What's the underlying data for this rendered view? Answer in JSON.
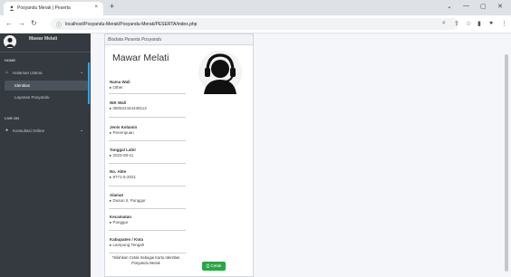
{
  "browser": {
    "tab_title": "Posyandu Merak | Peserta",
    "tab_close": "×",
    "new_tab": "+",
    "url": "localhost/Posyandu-Merak/Posyandu-Merak/PESERTA/index.php",
    "window_controls": [
      "⌄",
      "—",
      "▢",
      "✕"
    ]
  },
  "sidebar": {
    "brand_name": "Mawar Melati",
    "header_home": "HOME",
    "item_home": "Halaman Utama",
    "sub_items": [
      "Identitas",
      "Layanan Posyandu"
    ],
    "header_live": "LIVE ON",
    "item_consult": "Konsultasi Online"
  },
  "card": {
    "header": "Biodata Peserta Posyandu",
    "name": "Mawar Melati",
    "fields": [
      {
        "label": "Nama Wali",
        "value": "▸ Other"
      },
      {
        "label": "NIK Wali",
        "value": "▸ 080522444439113"
      },
      {
        "label": "Jenis Kelamin",
        "value": "▸ Perempuan"
      },
      {
        "label": "Tanggal Lahir",
        "value": "▸ 2023-08-11"
      },
      {
        "label": "No. Akte",
        "value": "▸ 8771-5-2021"
      },
      {
        "label": "Alamat",
        "value": "▸ Dusun II, Punggur"
      },
      {
        "label": "Kecamatan",
        "value": "▸ Punggur"
      },
      {
        "label": "Kabupaten / Kota",
        "value": "▸ Lampung Tengah"
      }
    ],
    "note": "*Silahkan Cetak Sebagai Kartu Identitas Posyandu Merak",
    "print_button": "Cetak"
  }
}
